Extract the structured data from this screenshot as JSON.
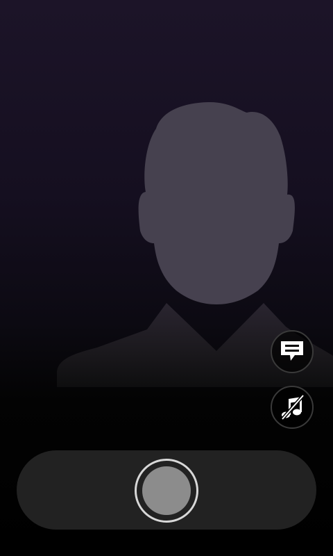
{
  "screen": {
    "name": "contact-video-screen"
  },
  "icons": {
    "avatar": "person-silhouette",
    "chat": "chat-bubble-icon",
    "music": "music-muted-icon",
    "capture": "record-button"
  },
  "colors": {
    "background_top": "#1c1428",
    "background_bottom": "#000000",
    "silhouette_head": "#46414f",
    "control_bar": "#222222",
    "capture_fill": "#8c8c8c",
    "capture_ring": "#d8d8d8"
  }
}
